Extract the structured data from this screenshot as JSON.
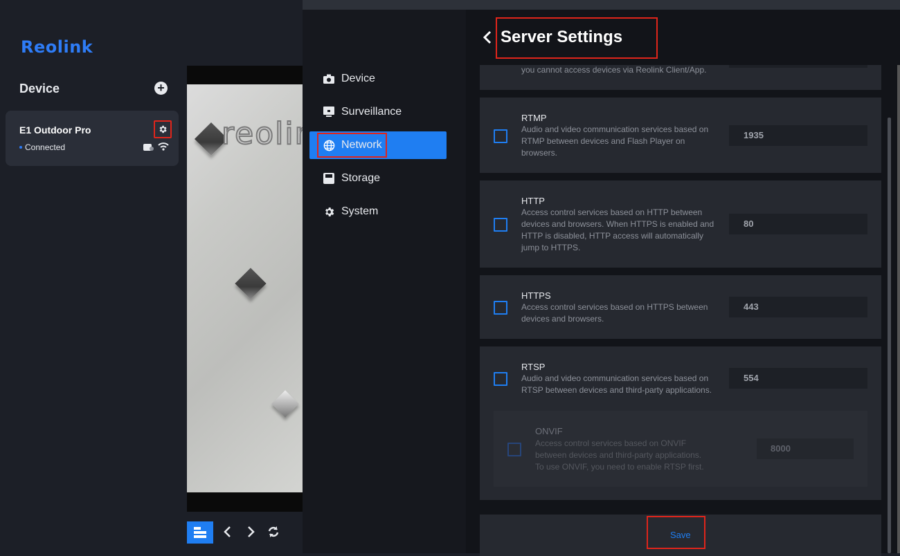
{
  "app": {
    "logo": "Reolink"
  },
  "sidebar": {
    "title": "Device",
    "device": {
      "name": "E1 Outdoor Pro",
      "status": "Connected"
    }
  },
  "video": {
    "watermark": "reolink"
  },
  "nav": {
    "items": [
      {
        "label": "Device",
        "icon": "camera-icon"
      },
      {
        "label": "Surveillance",
        "icon": "monitor-icon"
      },
      {
        "label": "Network",
        "icon": "globe-icon",
        "active": true
      },
      {
        "label": "Storage",
        "icon": "storage-icon"
      },
      {
        "label": "System",
        "icon": "gear-icon"
      }
    ]
  },
  "settings": {
    "title": "Server Settings",
    "partial_desc": "you cannot access devices via Reolink Client/App.",
    "services": [
      {
        "name": "RTMP",
        "desc": "Audio and video communication services based on RTMP between devices and Flash Player on browsers.",
        "desc_lines": [
          "Audio and video communication services based on",
          "RTMP between devices and Flash Player on",
          "browsers."
        ],
        "port": "1935"
      },
      {
        "name": "HTTP",
        "desc_lines": [
          "Access control services based on HTTP between",
          "devices and browsers. When HTTPS is enabled and",
          "HTTP is disabled, HTTP access will automatically",
          "jump to HTTPS."
        ],
        "port": "80"
      },
      {
        "name": "HTTPS",
        "desc_lines": [
          "Access control services based on HTTPS between",
          "devices and browsers."
        ],
        "port": "443"
      },
      {
        "name": "RTSP",
        "desc_lines": [
          "Audio and video communication services based on",
          "RTSP between devices and third-party applications."
        ],
        "port": "554"
      }
    ],
    "onvif": {
      "name": "ONVIF",
      "desc_lines": [
        "Access control services based on ONVIF",
        "between devices and third-party applications.",
        "To use ONVIF, you need to enable RTSP first."
      ],
      "port": "8000"
    },
    "save_label": "Save"
  },
  "colors": {
    "accent": "#1f7ef2",
    "highlight": "#e0251b",
    "panel": "#262930",
    "background": "#121419"
  }
}
